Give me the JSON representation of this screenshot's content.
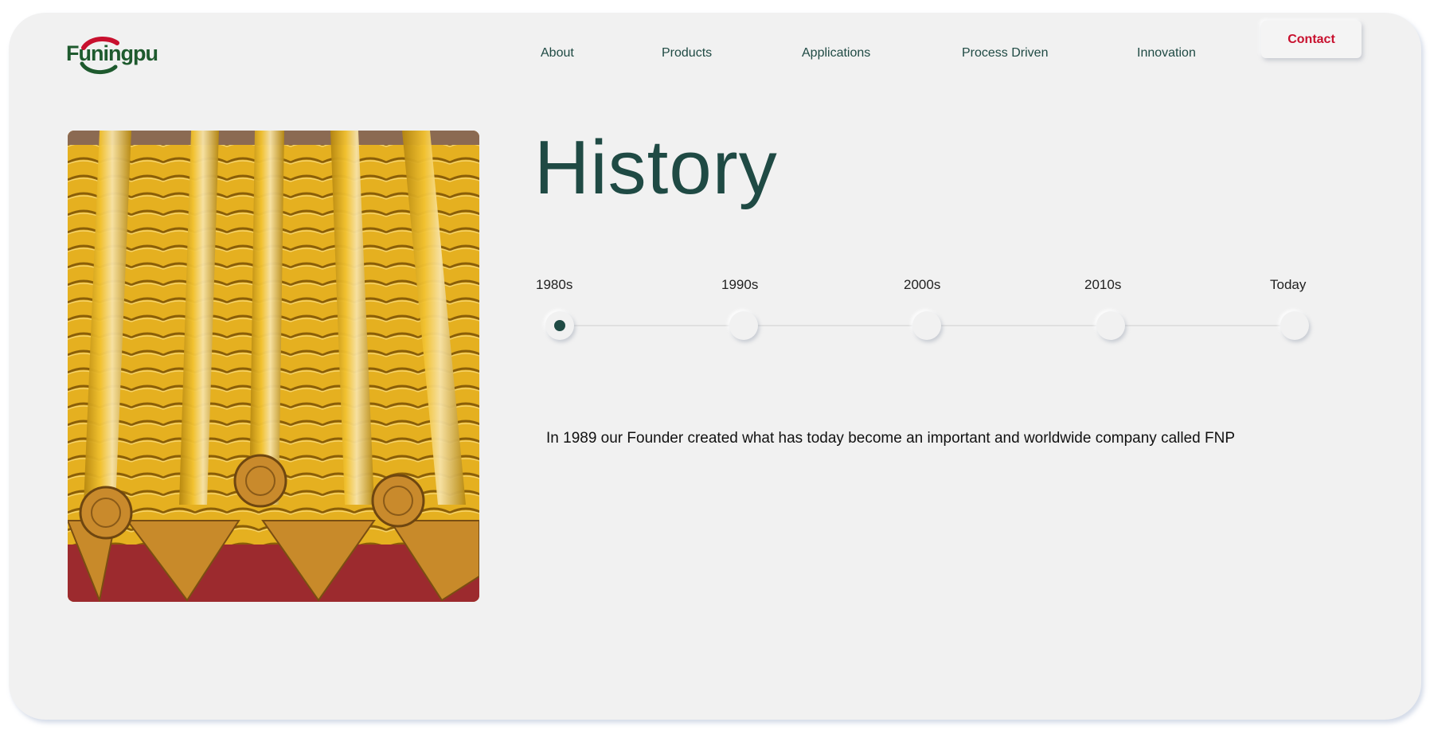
{
  "brand": {
    "logo_text": "Funingpu",
    "colors": {
      "green": "#1e5a2e",
      "red": "#c8102e",
      "teal": "#1f4a44"
    }
  },
  "nav": {
    "items": [
      {
        "label": "About"
      },
      {
        "label": "Products"
      },
      {
        "label": "Applications"
      },
      {
        "label": "Process Driven"
      },
      {
        "label": "Innovation"
      }
    ],
    "contact_label": "Contact"
  },
  "hero": {
    "image": "yellow-glazed-roof-tiles",
    "title": "History"
  },
  "timeline": {
    "items": [
      {
        "label": "1980s",
        "active": true
      },
      {
        "label": "1990s",
        "active": false
      },
      {
        "label": "2000s",
        "active": false
      },
      {
        "label": "2010s",
        "active": false
      },
      {
        "label": "Today",
        "active": false
      }
    ],
    "description": "In 1989 our Founder created what has today become an important and worldwide company called FNP"
  }
}
